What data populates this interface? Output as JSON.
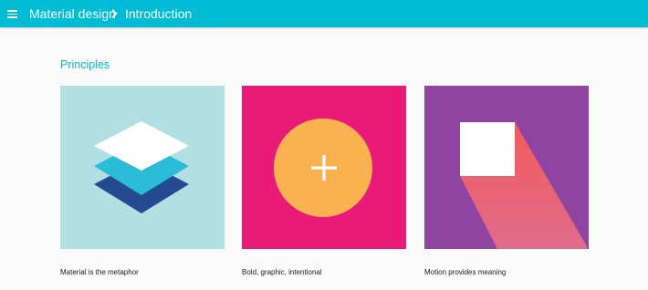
{
  "app_bar": {
    "background": "#00bcd4",
    "menu_icon": "menu-icon",
    "breadcrumb": {
      "root": "Material design",
      "separator_icon": "chevron-right-icon",
      "current": "Introduction"
    }
  },
  "section": {
    "title": "Principles",
    "title_color": "#00bcd4"
  },
  "cards": [
    {
      "caption": "Material is the metaphor",
      "illustration": "layers-icon",
      "background": "#b2dfe2"
    },
    {
      "caption": "Bold, graphic, intentional",
      "illustration": "plus-circle-icon",
      "background": "#e91a78"
    },
    {
      "caption": "Motion provides meaning",
      "illustration": "square-shadow-icon",
      "background": "#8e44a0"
    }
  ]
}
